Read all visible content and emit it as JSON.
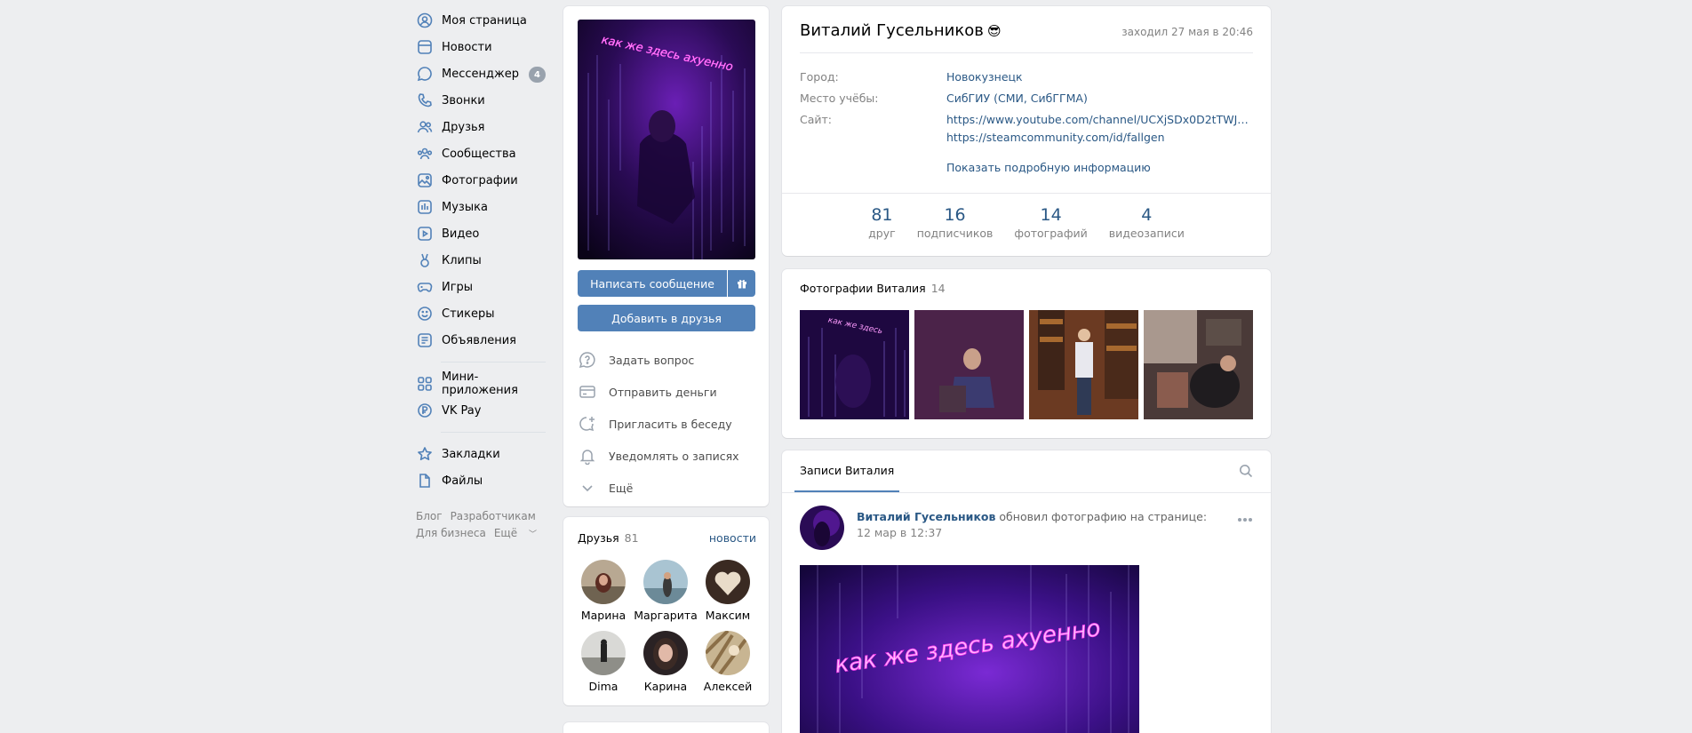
{
  "nav": {
    "items": [
      {
        "label": "Моя страница",
        "icon": "user-circle-icon"
      },
      {
        "label": "Новости",
        "icon": "news-icon"
      },
      {
        "label": "Мессенджер",
        "icon": "message-icon",
        "badge": "4"
      },
      {
        "label": "Звонки",
        "icon": "phone-icon"
      },
      {
        "label": "Друзья",
        "icon": "friends-icon"
      },
      {
        "label": "Сообщества",
        "icon": "communities-icon"
      },
      {
        "label": "Фотографии",
        "icon": "photos-icon"
      },
      {
        "label": "Музыка",
        "icon": "music-icon"
      },
      {
        "label": "Видео",
        "icon": "video-icon"
      },
      {
        "label": "Клипы",
        "icon": "clips-icon"
      },
      {
        "label": "Игры",
        "icon": "gamepad-icon"
      },
      {
        "label": "Стикеры",
        "icon": "sticker-icon"
      },
      {
        "label": "Объявления",
        "icon": "ads-icon"
      }
    ],
    "items2": [
      {
        "label": "Мини-приложения",
        "icon": "apps-icon"
      },
      {
        "label": "VK Pay",
        "icon": "vkpay-icon"
      }
    ],
    "items3": [
      {
        "label": "Закладки",
        "icon": "star-icon"
      },
      {
        "label": "Файлы",
        "icon": "file-icon"
      }
    ],
    "footer": {
      "blog": "Блог",
      "developers": "Разработчикам",
      "business": "Для бизнеса",
      "more": "Ещё"
    }
  },
  "profile": {
    "name": "Виталий Гусельников",
    "emoji": "😎",
    "last_seen": "заходил 27 мая в 20:46",
    "info": [
      {
        "label": "Город:",
        "values": [
          "Новокузнецк"
        ]
      },
      {
        "label": "Место учёбы:",
        "values": [
          "СибГИУ (СМИ, СибГГМА)"
        ]
      },
      {
        "label": "Сайт:",
        "values": [
          "https://www.youtube.com/channel/UCXjSDx0D2tTWJ4lX7...",
          "https://steamcommunity.com/id/fallgen"
        ]
      }
    ],
    "show_more": "Показать подробную информацию",
    "counters": [
      {
        "num": "81",
        "label": "друг"
      },
      {
        "num": "16",
        "label": "подписчиков"
      },
      {
        "num": "14",
        "label": "фотографий"
      },
      {
        "num": "4",
        "label": "видеозаписи"
      }
    ]
  },
  "avatar_card": {
    "avatar_text": "как же здесь ахуенно",
    "message_button": "Написать сообщение",
    "add_friend_button": "Добавить в друзья",
    "actions": [
      {
        "label": "Задать вопрос",
        "icon": "question-icon"
      },
      {
        "label": "Отправить деньги",
        "icon": "money-icon"
      },
      {
        "label": "Пригласить в беседу",
        "icon": "invite-chat-icon"
      },
      {
        "label": "Уведомлять о записях",
        "icon": "bell-icon"
      },
      {
        "label": "Ещё",
        "icon": "chevron-down-icon"
      }
    ]
  },
  "friends": {
    "title": "Друзья",
    "count": "81",
    "link": "новости",
    "list": [
      {
        "name": "Марина"
      },
      {
        "name": "Маргарита"
      },
      {
        "name": "Максим"
      },
      {
        "name": "Dima"
      },
      {
        "name": "Карина"
      },
      {
        "name": "Алексей"
      }
    ]
  },
  "photos": {
    "title": "Фотографии Виталия",
    "count": "14"
  },
  "wall": {
    "tab": "Записи Виталия",
    "post": {
      "author": "Виталий Гусельников",
      "action": " обновил фотографию на странице:",
      "date": "12 мар в 12:37"
    }
  },
  "colors": {
    "accent": "#5181b8",
    "link": "#2a5885",
    "background": "#edeef0",
    "neon": "#ff3cf0"
  }
}
